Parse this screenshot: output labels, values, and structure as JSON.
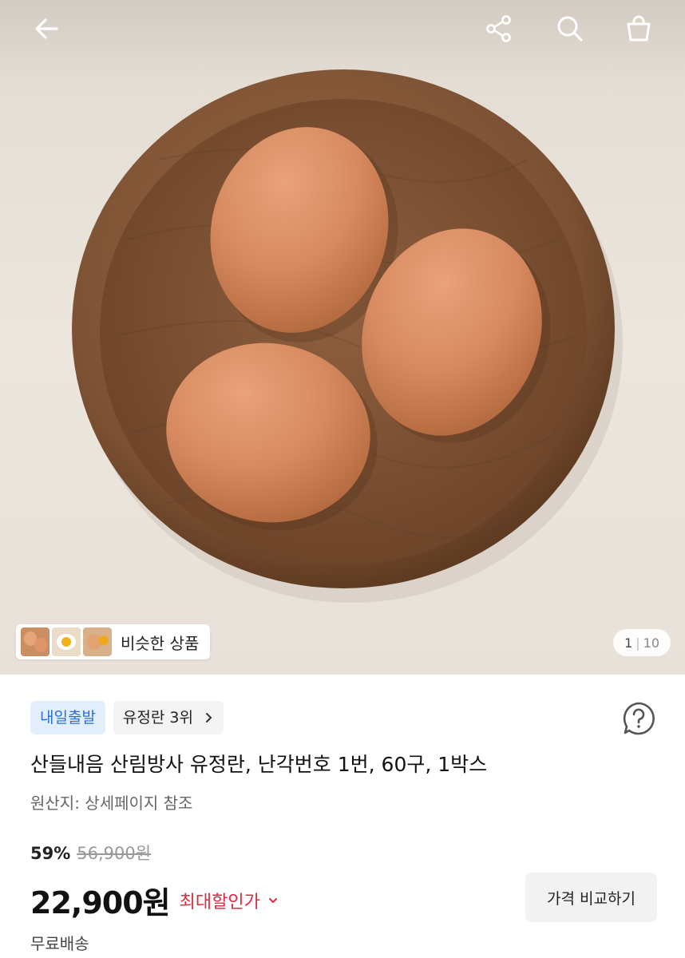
{
  "header": {
    "back_icon": "arrow-left-icon",
    "share_icon": "share-icon",
    "search_icon": "search-icon",
    "cart_icon": "shopping-bag-icon"
  },
  "gallery": {
    "similar_label": "비슷한 상품",
    "counter_current": "1",
    "counter_total": "10"
  },
  "product": {
    "badge_delivery": "내일출발",
    "badge_rank": "유정란 3위",
    "title": "산들내음 산림방사 유정란, 난각번호 1번, 60구, 1박스",
    "origin": "원산지: 상세페이지 참조",
    "discount_percent": "59%",
    "original_price": "56,900원",
    "price": "22,900원",
    "max_discount_label": "최대할인가",
    "compare_button": "가격 비교하기",
    "shipping": "무료배송"
  },
  "colors": {
    "accent_red": "#e4283f",
    "badge_blue": "#2b6fd6",
    "badge_blue_bg": "#e3eefc"
  }
}
